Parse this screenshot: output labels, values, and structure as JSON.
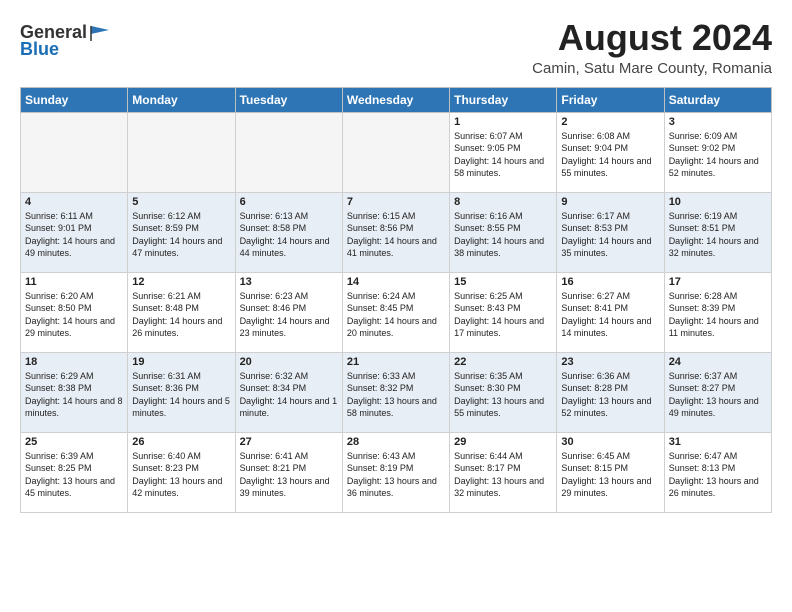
{
  "logo": {
    "general": "General",
    "blue": "Blue"
  },
  "title": "August 2024",
  "subtitle": "Camin, Satu Mare County, Romania",
  "weekdays": [
    "Sunday",
    "Monday",
    "Tuesday",
    "Wednesday",
    "Thursday",
    "Friday",
    "Saturday"
  ],
  "weeks": [
    [
      {
        "day": "",
        "sunrise": "",
        "sunset": "",
        "daylight": ""
      },
      {
        "day": "",
        "sunrise": "",
        "sunset": "",
        "daylight": ""
      },
      {
        "day": "",
        "sunrise": "",
        "sunset": "",
        "daylight": ""
      },
      {
        "day": "",
        "sunrise": "",
        "sunset": "",
        "daylight": ""
      },
      {
        "day": "1",
        "sunrise": "Sunrise: 6:07 AM",
        "sunset": "Sunset: 9:05 PM",
        "daylight": "Daylight: 14 hours and 58 minutes."
      },
      {
        "day": "2",
        "sunrise": "Sunrise: 6:08 AM",
        "sunset": "Sunset: 9:04 PM",
        "daylight": "Daylight: 14 hours and 55 minutes."
      },
      {
        "day": "3",
        "sunrise": "Sunrise: 6:09 AM",
        "sunset": "Sunset: 9:02 PM",
        "daylight": "Daylight: 14 hours and 52 minutes."
      }
    ],
    [
      {
        "day": "4",
        "sunrise": "Sunrise: 6:11 AM",
        "sunset": "Sunset: 9:01 PM",
        "daylight": "Daylight: 14 hours and 49 minutes."
      },
      {
        "day": "5",
        "sunrise": "Sunrise: 6:12 AM",
        "sunset": "Sunset: 8:59 PM",
        "daylight": "Daylight: 14 hours and 47 minutes."
      },
      {
        "day": "6",
        "sunrise": "Sunrise: 6:13 AM",
        "sunset": "Sunset: 8:58 PM",
        "daylight": "Daylight: 14 hours and 44 minutes."
      },
      {
        "day": "7",
        "sunrise": "Sunrise: 6:15 AM",
        "sunset": "Sunset: 8:56 PM",
        "daylight": "Daylight: 14 hours and 41 minutes."
      },
      {
        "day": "8",
        "sunrise": "Sunrise: 6:16 AM",
        "sunset": "Sunset: 8:55 PM",
        "daylight": "Daylight: 14 hours and 38 minutes."
      },
      {
        "day": "9",
        "sunrise": "Sunrise: 6:17 AM",
        "sunset": "Sunset: 8:53 PM",
        "daylight": "Daylight: 14 hours and 35 minutes."
      },
      {
        "day": "10",
        "sunrise": "Sunrise: 6:19 AM",
        "sunset": "Sunset: 8:51 PM",
        "daylight": "Daylight: 14 hours and 32 minutes."
      }
    ],
    [
      {
        "day": "11",
        "sunrise": "Sunrise: 6:20 AM",
        "sunset": "Sunset: 8:50 PM",
        "daylight": "Daylight: 14 hours and 29 minutes."
      },
      {
        "day": "12",
        "sunrise": "Sunrise: 6:21 AM",
        "sunset": "Sunset: 8:48 PM",
        "daylight": "Daylight: 14 hours and 26 minutes."
      },
      {
        "day": "13",
        "sunrise": "Sunrise: 6:23 AM",
        "sunset": "Sunset: 8:46 PM",
        "daylight": "Daylight: 14 hours and 23 minutes."
      },
      {
        "day": "14",
        "sunrise": "Sunrise: 6:24 AM",
        "sunset": "Sunset: 8:45 PM",
        "daylight": "Daylight: 14 hours and 20 minutes."
      },
      {
        "day": "15",
        "sunrise": "Sunrise: 6:25 AM",
        "sunset": "Sunset: 8:43 PM",
        "daylight": "Daylight: 14 hours and 17 minutes."
      },
      {
        "day": "16",
        "sunrise": "Sunrise: 6:27 AM",
        "sunset": "Sunset: 8:41 PM",
        "daylight": "Daylight: 14 hours and 14 minutes."
      },
      {
        "day": "17",
        "sunrise": "Sunrise: 6:28 AM",
        "sunset": "Sunset: 8:39 PM",
        "daylight": "Daylight: 14 hours and 11 minutes."
      }
    ],
    [
      {
        "day": "18",
        "sunrise": "Sunrise: 6:29 AM",
        "sunset": "Sunset: 8:38 PM",
        "daylight": "Daylight: 14 hours and 8 minutes."
      },
      {
        "day": "19",
        "sunrise": "Sunrise: 6:31 AM",
        "sunset": "Sunset: 8:36 PM",
        "daylight": "Daylight: 14 hours and 5 minutes."
      },
      {
        "day": "20",
        "sunrise": "Sunrise: 6:32 AM",
        "sunset": "Sunset: 8:34 PM",
        "daylight": "Daylight: 14 hours and 1 minute."
      },
      {
        "day": "21",
        "sunrise": "Sunrise: 6:33 AM",
        "sunset": "Sunset: 8:32 PM",
        "daylight": "Daylight: 13 hours and 58 minutes."
      },
      {
        "day": "22",
        "sunrise": "Sunrise: 6:35 AM",
        "sunset": "Sunset: 8:30 PM",
        "daylight": "Daylight: 13 hours and 55 minutes."
      },
      {
        "day": "23",
        "sunrise": "Sunrise: 6:36 AM",
        "sunset": "Sunset: 8:28 PM",
        "daylight": "Daylight: 13 hours and 52 minutes."
      },
      {
        "day": "24",
        "sunrise": "Sunrise: 6:37 AM",
        "sunset": "Sunset: 8:27 PM",
        "daylight": "Daylight: 13 hours and 49 minutes."
      }
    ],
    [
      {
        "day": "25",
        "sunrise": "Sunrise: 6:39 AM",
        "sunset": "Sunset: 8:25 PM",
        "daylight": "Daylight: 13 hours and 45 minutes."
      },
      {
        "day": "26",
        "sunrise": "Sunrise: 6:40 AM",
        "sunset": "Sunset: 8:23 PM",
        "daylight": "Daylight: 13 hours and 42 minutes."
      },
      {
        "day": "27",
        "sunrise": "Sunrise: 6:41 AM",
        "sunset": "Sunset: 8:21 PM",
        "daylight": "Daylight: 13 hours and 39 minutes."
      },
      {
        "day": "28",
        "sunrise": "Sunrise: 6:43 AM",
        "sunset": "Sunset: 8:19 PM",
        "daylight": "Daylight: 13 hours and 36 minutes."
      },
      {
        "day": "29",
        "sunrise": "Sunrise: 6:44 AM",
        "sunset": "Sunset: 8:17 PM",
        "daylight": "Daylight: 13 hours and 32 minutes."
      },
      {
        "day": "30",
        "sunrise": "Sunrise: 6:45 AM",
        "sunset": "Sunset: 8:15 PM",
        "daylight": "Daylight: 13 hours and 29 minutes."
      },
      {
        "day": "31",
        "sunrise": "Sunrise: 6:47 AM",
        "sunset": "Sunset: 8:13 PM",
        "daylight": "Daylight: 13 hours and 26 minutes."
      }
    ]
  ]
}
